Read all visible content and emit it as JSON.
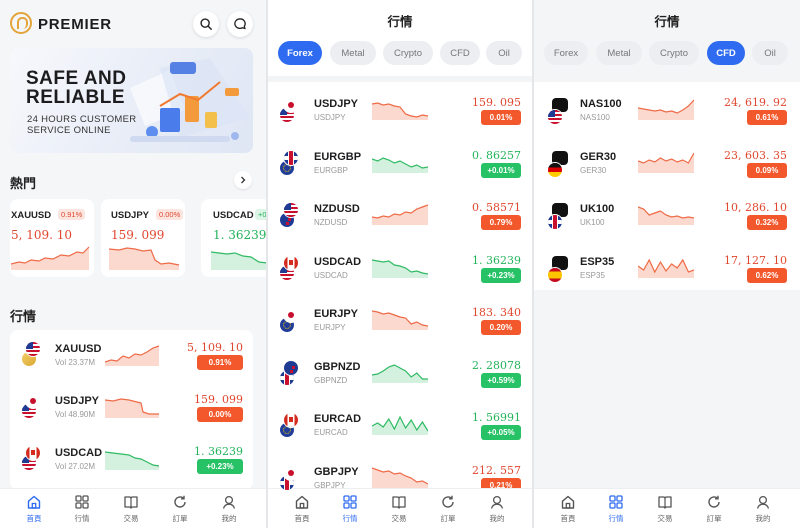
{
  "home": {
    "brand": "PREMIER",
    "banner": {
      "line1": "SAFE AND",
      "line2": "RELIABLE",
      "sub1": "24 HOURS CUSTOMER",
      "sub2": "SERVICE ONLINE"
    },
    "hot_title": "熱門",
    "hot_cards": [
      {
        "symbol": "XAUUSD",
        "pct": "0.91%",
        "price": "5, 109. 10",
        "trend": "up"
      },
      {
        "symbol": "USDJPY",
        "pct": "0.00%",
        "price": "159. 099",
        "trend": "down"
      },
      {
        "symbol": "USDCAD",
        "pct": "+0",
        "price": "1. 36239",
        "trend": "down"
      }
    ],
    "market_title": "行情",
    "list": [
      {
        "symbol": "XAUUSD",
        "vol": "Vol 23.37M",
        "price": "5, 109. 10",
        "change": "0.91%",
        "dir": "up"
      },
      {
        "symbol": "USDJPY",
        "vol": "Vol 48.90M",
        "price": "159. 099",
        "change": "0.00%",
        "dir": "down"
      },
      {
        "symbol": "USDCAD",
        "vol": "Vol 27.02M",
        "price": "1. 36239",
        "change": "+0.23%",
        "dir": "green"
      }
    ]
  },
  "forex": {
    "title": "行情",
    "tabs": [
      "Forex",
      "Metal",
      "Crypto",
      "CFD",
      "Oil"
    ],
    "rows": [
      {
        "symbol": "USDJPY",
        "sub": "USDJPY",
        "price": "159. 095",
        "change": "0.01%",
        "color": "red"
      },
      {
        "symbol": "EURGBP",
        "sub": "EURGBP",
        "price": "0. 86257",
        "change": "+0.01%",
        "color": "green"
      },
      {
        "symbol": "NZDUSD",
        "sub": "NZDUSD",
        "price": "0. 58571",
        "change": "0.79%",
        "color": "red"
      },
      {
        "symbol": "USDCAD",
        "sub": "USDCAD",
        "price": "1. 36239",
        "change": "+0.23%",
        "color": "green"
      },
      {
        "symbol": "EURJPY",
        "sub": "EURJPY",
        "price": "183. 340",
        "change": "0.20%",
        "color": "red"
      },
      {
        "symbol": "GBPNZD",
        "sub": "GBPNZD",
        "price": "2. 28078",
        "change": "+0.59%",
        "color": "green"
      },
      {
        "symbol": "EURCAD",
        "sub": "EURCAD",
        "price": "1. 56991",
        "change": "+0.05%",
        "color": "green"
      },
      {
        "symbol": "GBPJPY",
        "sub": "GBPJPY",
        "price": "212. 557",
        "change": "0.21%",
        "color": "red"
      }
    ]
  },
  "cfd": {
    "title": "行情",
    "tabs": [
      "Forex",
      "Metal",
      "Crypto",
      "CFD",
      "Oil"
    ],
    "rows": [
      {
        "symbol": "NAS100",
        "sub": "NAS100",
        "price": "24, 619. 92",
        "change": "0.61%",
        "color": "red"
      },
      {
        "symbol": "GER30",
        "sub": "GER30",
        "price": "23, 603. 35",
        "change": "0.09%",
        "color": "red"
      },
      {
        "symbol": "UK100",
        "sub": "UK100",
        "price": "10, 286. 10",
        "change": "0.32%",
        "color": "red"
      },
      {
        "symbol": "ESP35",
        "sub": "ESP35",
        "price": "17, 127. 10",
        "change": "0.62%",
        "color": "red"
      }
    ]
  },
  "nav": [
    "首頁",
    "行情",
    "交易",
    "訂單",
    "我的"
  ],
  "colors": {
    "accent": "#2f6bf0",
    "up_red": "#f2582c",
    "down_green": "#27c266"
  }
}
